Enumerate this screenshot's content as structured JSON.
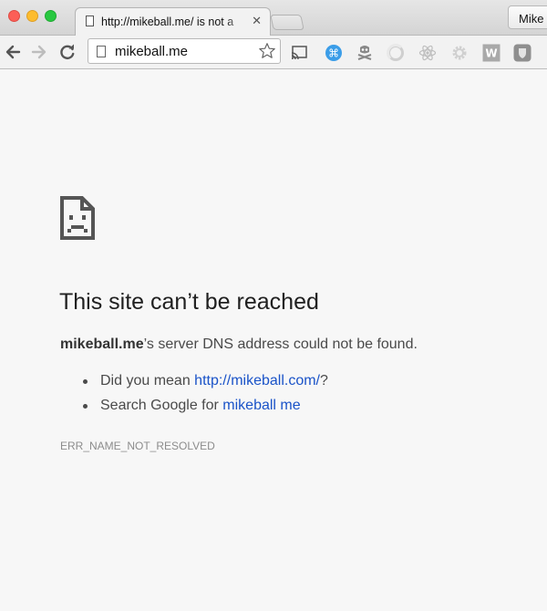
{
  "window": {
    "tab_title": "http://mikeball.me/ is not a",
    "tab_close": "✕",
    "profile_name": "Mike"
  },
  "toolbar": {
    "address": "mikeball.me",
    "extensions": [
      "cast-icon",
      "app-extension-icon",
      "pirate-skull-icon",
      "ring-extension-icon",
      "react-devtools-icon",
      "gear-extension-icon",
      "w-extension-icon",
      "shield-extension-icon"
    ]
  },
  "error_page": {
    "heading": "This site can’t be reached",
    "summary_host": "mikeball.me",
    "summary_rest": "’s server DNS address could not be found.",
    "suggestion1_prefix": "Did you mean ",
    "suggestion1_link": "http://mikeball.com/",
    "suggestion1_suffix": "?",
    "suggestion2_prefix": "Search Google for ",
    "suggestion2_link": "mikeball me",
    "error_code": "ERR_NAME_NOT_RESOLVED"
  },
  "colors": {
    "link": "#1a53c8",
    "background": "#f7f7f7"
  }
}
